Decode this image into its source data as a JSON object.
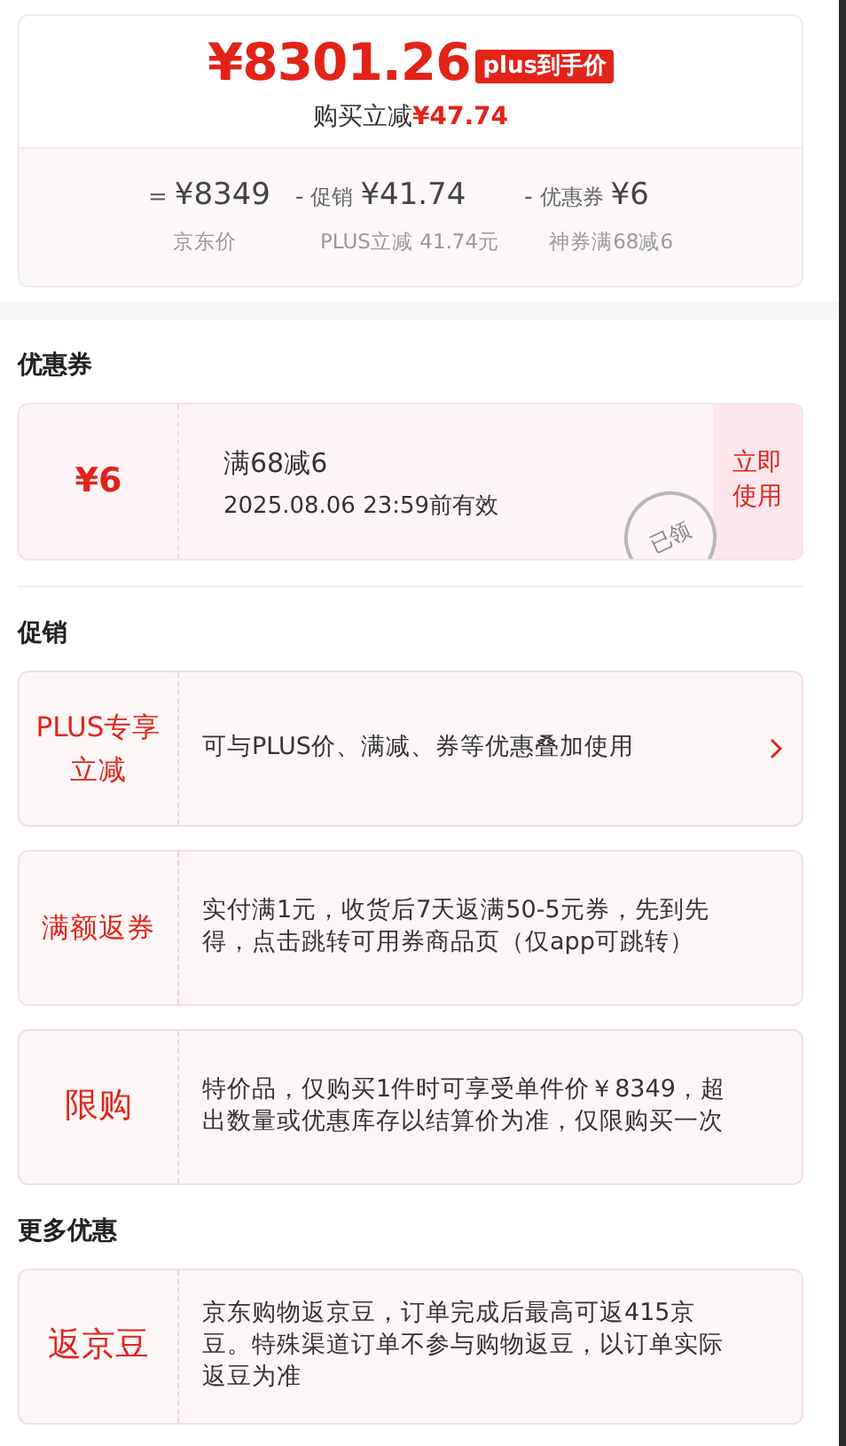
{
  "price_card": {
    "price": "¥8301.26",
    "price_tag": "plus到手价",
    "saving_label": "购买立减",
    "saving_amount": "¥47.74",
    "breakdown": [
      {
        "operator": "=",
        "amount": "¥8349",
        "note": "京东价"
      },
      {
        "operator": "-",
        "label": "促销",
        "amount": "¥41.74",
        "note": "PLUS立减 41.74元"
      },
      {
        "operator": "-",
        "label": "优惠券",
        "amount": "¥6",
        "note": "神券满68减6"
      }
    ]
  },
  "coupon_section": {
    "title": "优惠券",
    "coupon": {
      "value": "¥6",
      "condition": "满68减6",
      "validity": "2025.08.06 23:59前有效",
      "stamp": "已领",
      "action": "立即使用"
    }
  },
  "promo_section": {
    "title": "促销",
    "items": [
      {
        "label": "PLUS专享立减",
        "text": "可与PLUS价、满减、券等优惠叠加使用",
        "has_arrow": true
      },
      {
        "label": "满额返券",
        "text": "实付满1元，收货后7天返满50-5元券，先到先得，点击跳转可用券商品页（仅app可跳转）",
        "has_arrow": false
      },
      {
        "label": "限购",
        "text": "特价品，仅购买1件时可享受单件价￥8349，超出数量或优惠库存以结算价为准，仅限购买一次",
        "has_arrow": false
      }
    ]
  },
  "more_section": {
    "title": "更多优惠",
    "items": [
      {
        "label": "返京豆",
        "text": "京东购物返京豆，订单完成后最高可返415京豆。特殊渠道订单不参与购物返豆，以订单实际返豆为准",
        "has_arrow": false
      }
    ]
  }
}
